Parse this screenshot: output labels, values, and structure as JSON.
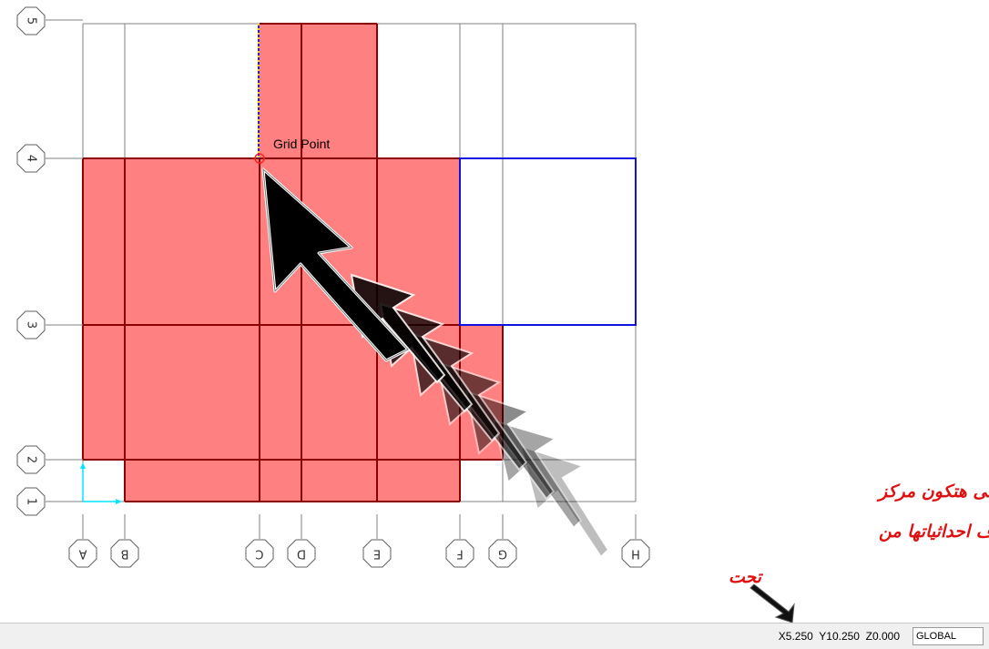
{
  "grid": {
    "columns": [
      "A",
      "B",
      "C",
      "D",
      "E",
      "F",
      "G",
      "H"
    ],
    "rows": [
      "1",
      "2",
      "3",
      "4",
      "5"
    ]
  },
  "snap_label": "Grid Point",
  "annotation": {
    "line1": "احدد على النقطه اللى هتكون مركز",
    "line2": "الدوران عشان اعرف احداثياتها من",
    "line3": "تحت"
  },
  "status": {
    "coordinates": "X5.250  Y10.250  Z0.000",
    "coord_system": "GLOBAL"
  },
  "colors": {
    "slab_fill": "#ff8080",
    "beam": "#8b0000",
    "selection": "#1010e0",
    "gridline": "#808080",
    "axis": "#00e5ff",
    "annotation_text": "#e01010"
  }
}
